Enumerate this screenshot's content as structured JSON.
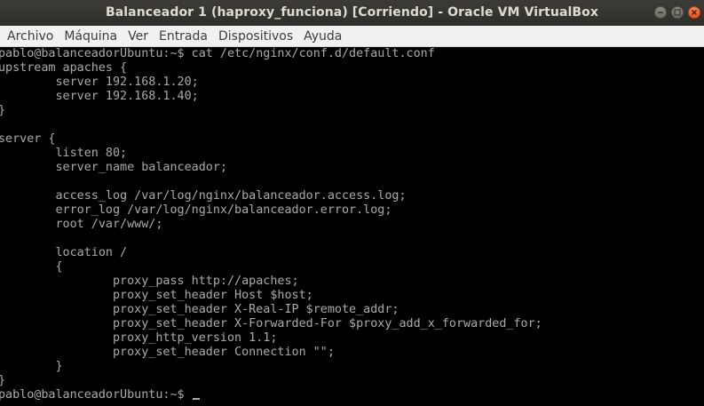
{
  "window": {
    "title": "Balanceador 1 (haproxy_funciona) [Corriendo] - Oracle VM VirtualBox",
    "buttons": {
      "minimize_icon": "minimize-icon",
      "maximize_icon": "maximize-icon",
      "close_icon": "close-icon"
    }
  },
  "menubar": {
    "items": [
      "Archivo",
      "Máquina",
      "Ver",
      "Entrada",
      "Dispositivos",
      "Ayuda"
    ]
  },
  "terminal": {
    "colors": {
      "background": "#000000",
      "text": "#aaaaaa"
    },
    "lines": [
      "pablo@balanceadorUbuntu:~$ cat /etc/nginx/conf.d/default.conf",
      "upstream apaches {",
      "        server 192.168.1.20;",
      "        server 192.168.1.40;",
      "}",
      "",
      "server {",
      "        listen 80;",
      "        server_name balanceador;",
      "",
      "        access_log /var/log/nginx/balanceador.access.log;",
      "        error_log /var/log/nginx/balanceador.error.log;",
      "        root /var/www/;",
      "",
      "        location /",
      "        {",
      "                proxy_pass http://apaches;",
      "                proxy_set_header Host $host;",
      "                proxy_set_header X-Real-IP $remote_addr;",
      "                proxy_set_header X-Forwarded-For $proxy_add_x_forwarded_for;",
      "                proxy_http_version 1.1;",
      "                proxy_set_header Connection \"\";",
      "        }",
      "}"
    ],
    "prompt": "pablo@balanceadorUbuntu:~$ "
  }
}
